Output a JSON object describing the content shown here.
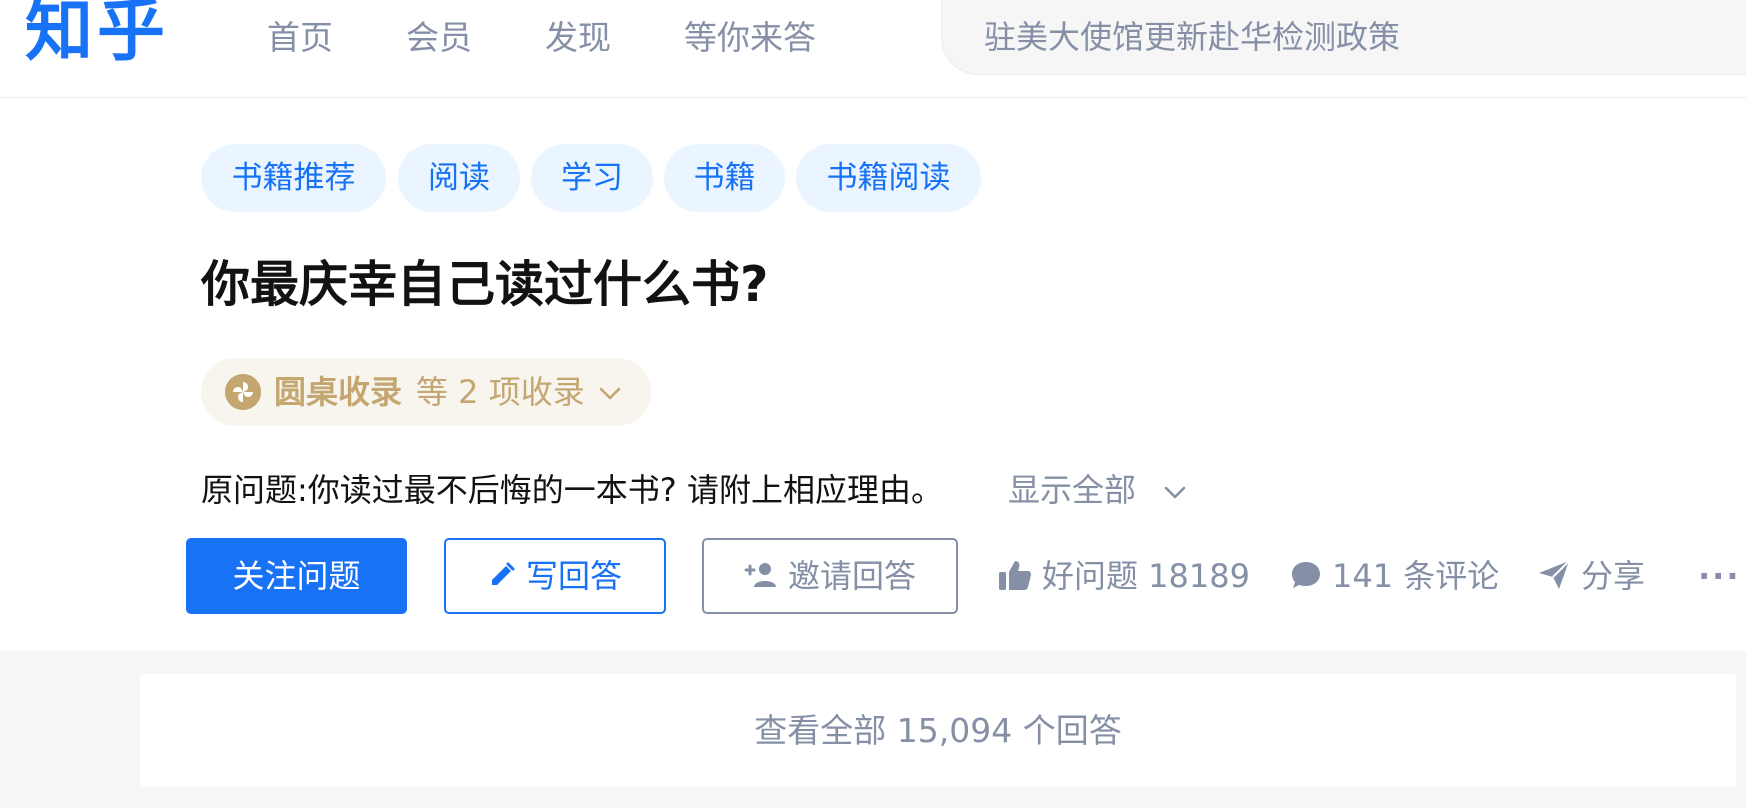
{
  "brand": {
    "logo": "知乎",
    "color": "#1772f6"
  },
  "nav": {
    "items": [
      "首页",
      "会员",
      "发现",
      "等你来答"
    ]
  },
  "search": {
    "placeholder": "驻美大使馆更新赴华检测政策"
  },
  "question": {
    "tags": [
      "书籍推荐",
      "阅读",
      "学习",
      "书籍",
      "书籍阅读"
    ],
    "title": "你最庆幸自己读过什么书?",
    "collection": {
      "main": "圆桌收录",
      "sub": "等 2 项收录",
      "color": "#c3a670"
    },
    "original": "原问题:你读过最不后悔的一本书? 请附上相应理由。",
    "show_all": "显示全部"
  },
  "actions": {
    "follow": "关注问题",
    "write": "写回答",
    "invite": "邀请回答",
    "good_question": "好问题 18189",
    "comments": "141 条评论",
    "share": "分享",
    "more": "···"
  },
  "answers": {
    "view_all": "查看全部 15,094 个回答"
  },
  "icons": [
    "pencil-icon",
    "add-user-icon",
    "thumbs-up-icon",
    "comment-icon",
    "paper-plane-icon",
    "more-icon",
    "chevron-down-icon",
    "collection-icon"
  ]
}
